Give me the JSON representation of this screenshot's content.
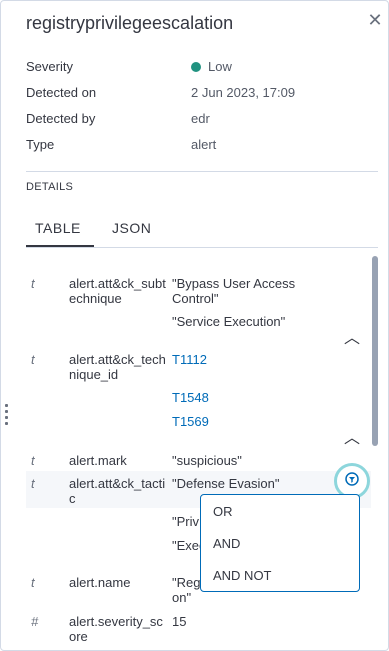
{
  "title": "registryprivilegeescalation",
  "meta": {
    "severity_label": "Severity",
    "severity_value": "Low",
    "severity_color": "#209280",
    "detected_on_label": "Detected on",
    "detected_on_value": "2 Jun 2023, 17:09",
    "detected_by_label": "Detected by",
    "detected_by_value": "edr",
    "type_label": "Type",
    "type_value": "alert"
  },
  "details_heading": "DETAILS",
  "tabs": [
    {
      "label": "TABLE",
      "active": true
    },
    {
      "label": "JSON",
      "active": false
    }
  ],
  "rows": [
    {
      "type": "t",
      "field": "alert.att&ck_subtechnique",
      "values": [
        "\"Bypass User Access Control\"",
        "\"Service Execution\""
      ]
    },
    {
      "type": "t",
      "field": "alert.att&ck_technique_id",
      "values": [
        "T1112",
        "T1548",
        "T1569"
      ]
    },
    {
      "type": "t",
      "field": "alert.mark",
      "values": [
        "\"suspicious\""
      ]
    },
    {
      "type": "t",
      "field": "alert.att&ck_tactic",
      "values": [
        "\"Defense Evasion\"",
        "\"Priv",
        "\"Exec"
      ]
    },
    {
      "type": "t",
      "field": "alert.name",
      "values": [
        "\"Reg",
        "on\""
      ]
    },
    {
      "type": "#",
      "field": "alert.severity_score",
      "values": [
        "15"
      ]
    }
  ],
  "popover": {
    "options": [
      "OR",
      "AND",
      "AND NOT"
    ]
  },
  "colors": {
    "accent": "#006bb8",
    "focus_ring": "#8dd6dc"
  },
  "icons": {
    "close": "close-icon",
    "collapse": "chevron-up-icon",
    "filter_action": "filter-action-icon",
    "drag": "drag-handle-icon"
  }
}
